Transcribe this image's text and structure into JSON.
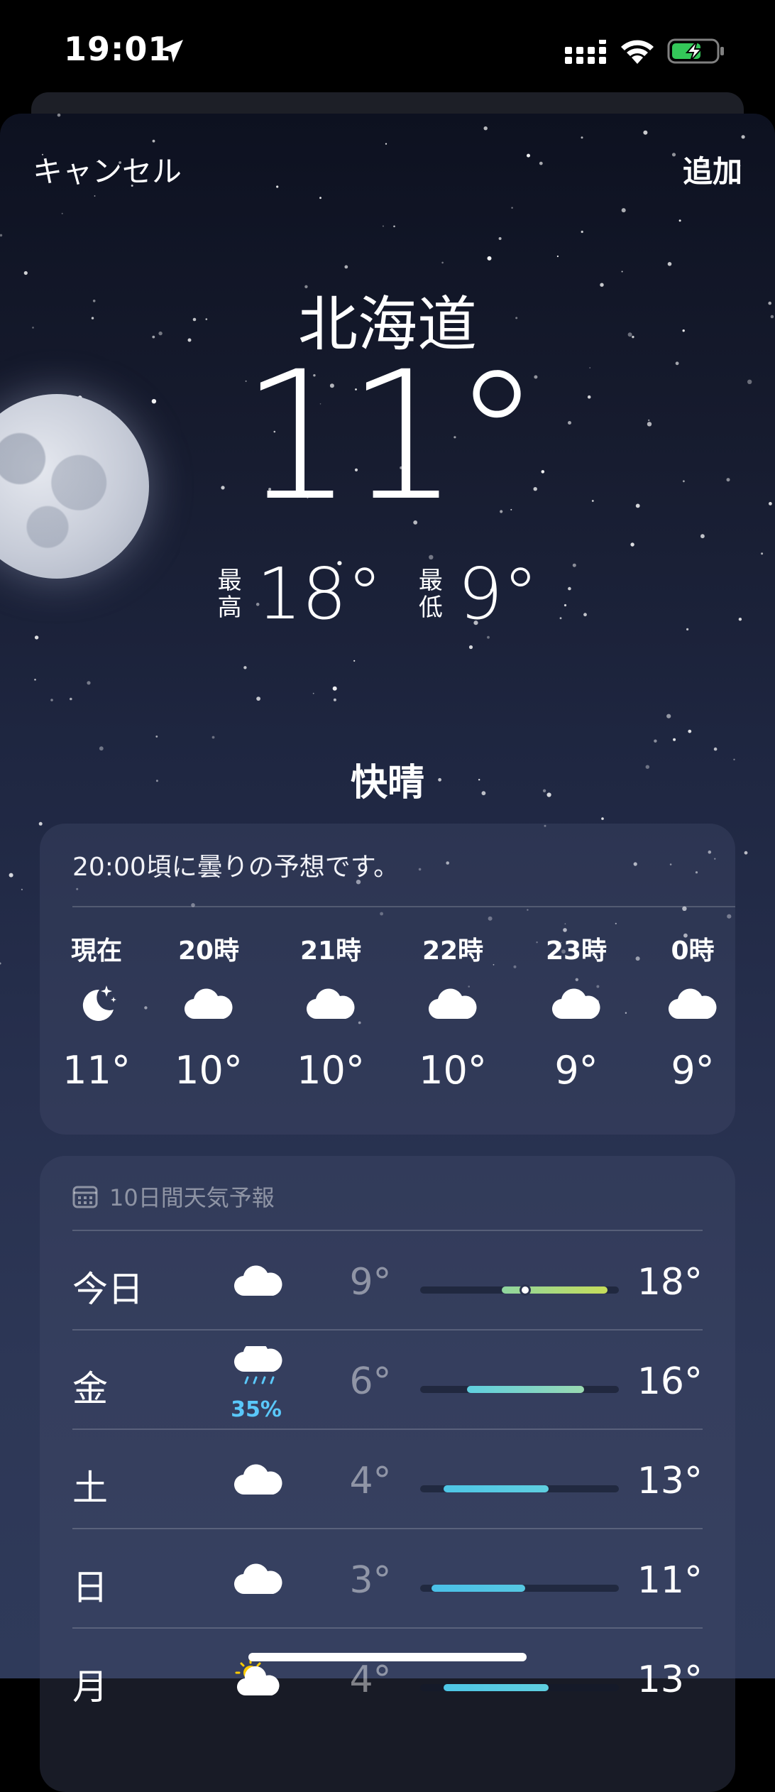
{
  "status_bar": {
    "time": "19:01"
  },
  "nav": {
    "cancel_label": "キャンセル",
    "add_label": "追加"
  },
  "current": {
    "city": "北海道",
    "temperature": "11°",
    "high_label": "最高",
    "high": "18°",
    "low_label": "最低",
    "low": "9°",
    "condition": "快晴"
  },
  "hourly": {
    "summary": "20:00頃に曇りの予想です。",
    "items": [
      {
        "label": "現在",
        "icon": "moon-stars-icon",
        "temp": "11°"
      },
      {
        "label": "20時",
        "icon": "cloud-icon",
        "temp": "10°"
      },
      {
        "label": "21時",
        "icon": "cloud-icon",
        "temp": "10°"
      },
      {
        "label": "22時",
        "icon": "cloud-icon",
        "temp": "10°"
      },
      {
        "label": "23時",
        "icon": "cloud-icon",
        "temp": "9°"
      },
      {
        "label": "0時",
        "icon": "cloud-icon",
        "temp": "9°"
      }
    ]
  },
  "daily": {
    "header": "10日間天気予報",
    "items": [
      {
        "day": "今日",
        "icon": "cloud-icon",
        "precip": "",
        "low": "9°",
        "high": "18°",
        "range": [
          9,
          18
        ],
        "current": 11,
        "colors": [
          "#8fd6a0",
          "#c6dd5a"
        ]
      },
      {
        "day": "金",
        "icon": "cloud-rain-icon",
        "precip": "35%",
        "low": "6°",
        "high": "16°",
        "range": [
          6,
          16
        ],
        "colors": [
          "#5fcfe0",
          "#9ad9b0"
        ]
      },
      {
        "day": "土",
        "icon": "cloud-icon",
        "precip": "",
        "low": "4°",
        "high": "13°",
        "range": [
          4,
          13
        ],
        "colors": [
          "#4ec6e6",
          "#5fcfe0"
        ]
      },
      {
        "day": "日",
        "icon": "cloud-icon",
        "precip": "",
        "low": "3°",
        "high": "11°",
        "range": [
          3,
          11
        ],
        "colors": [
          "#4ac0e8",
          "#56c8e2"
        ]
      },
      {
        "day": "月",
        "icon": "sun-cloud-icon",
        "precip": "",
        "low": "4°",
        "high": "13°",
        "range": [
          4,
          13
        ],
        "colors": [
          "#4ec6e6",
          "#5fcfe0"
        ]
      }
    ],
    "scale": [
      2,
      19
    ],
    "colors": {
      "accent": "#5ac8fa"
    }
  }
}
